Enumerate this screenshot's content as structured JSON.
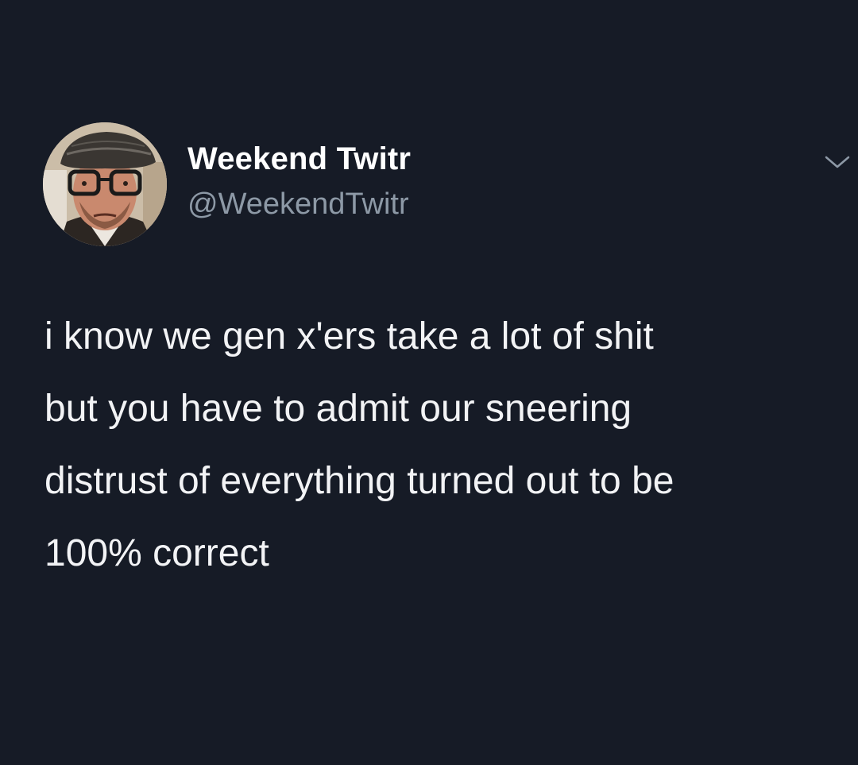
{
  "tweet": {
    "display_name": "Weekend Twitr",
    "handle": "@WeekendTwitr",
    "text_lines": [
      "i know we gen x'ers take a lot of shit",
      "but you have to admit our sneering",
      "distrust of everything turned out to be",
      "100% correct"
    ]
  },
  "icons": {
    "avatar": "profile-photo",
    "menu": "chevron-down-icon"
  },
  "colors": {
    "background": "#161b26",
    "name": "#ffffff",
    "handle": "#8d99a6",
    "text": "#f2f3f5"
  }
}
